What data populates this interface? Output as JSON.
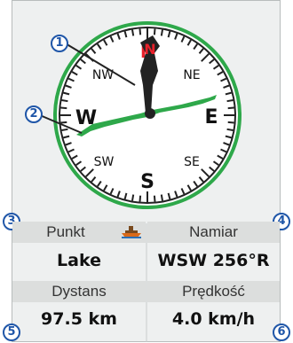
{
  "compass": {
    "north_label": "N",
    "south_label": "S",
    "east_label": "E",
    "west_label": "W",
    "nw_label": "NW",
    "ne_label": "NE",
    "sw_label": "SW",
    "se_label": "SE",
    "north_color": "#e8202a",
    "bearing_pointer_color": "#2ea84a"
  },
  "callouts": [
    "1",
    "2",
    "3",
    "4",
    "5",
    "6"
  ],
  "fields": {
    "point_label": "Punkt",
    "point_value": "Lake",
    "bearing_label": "Namiar",
    "bearing_value": "WSW 256°R",
    "distance_label": "Dystans",
    "distance_value": "97.5 km",
    "speed_label": "Prędkość",
    "speed_value": "4.0 km/h"
  },
  "icons": {
    "point_icon": "boat-icon"
  }
}
